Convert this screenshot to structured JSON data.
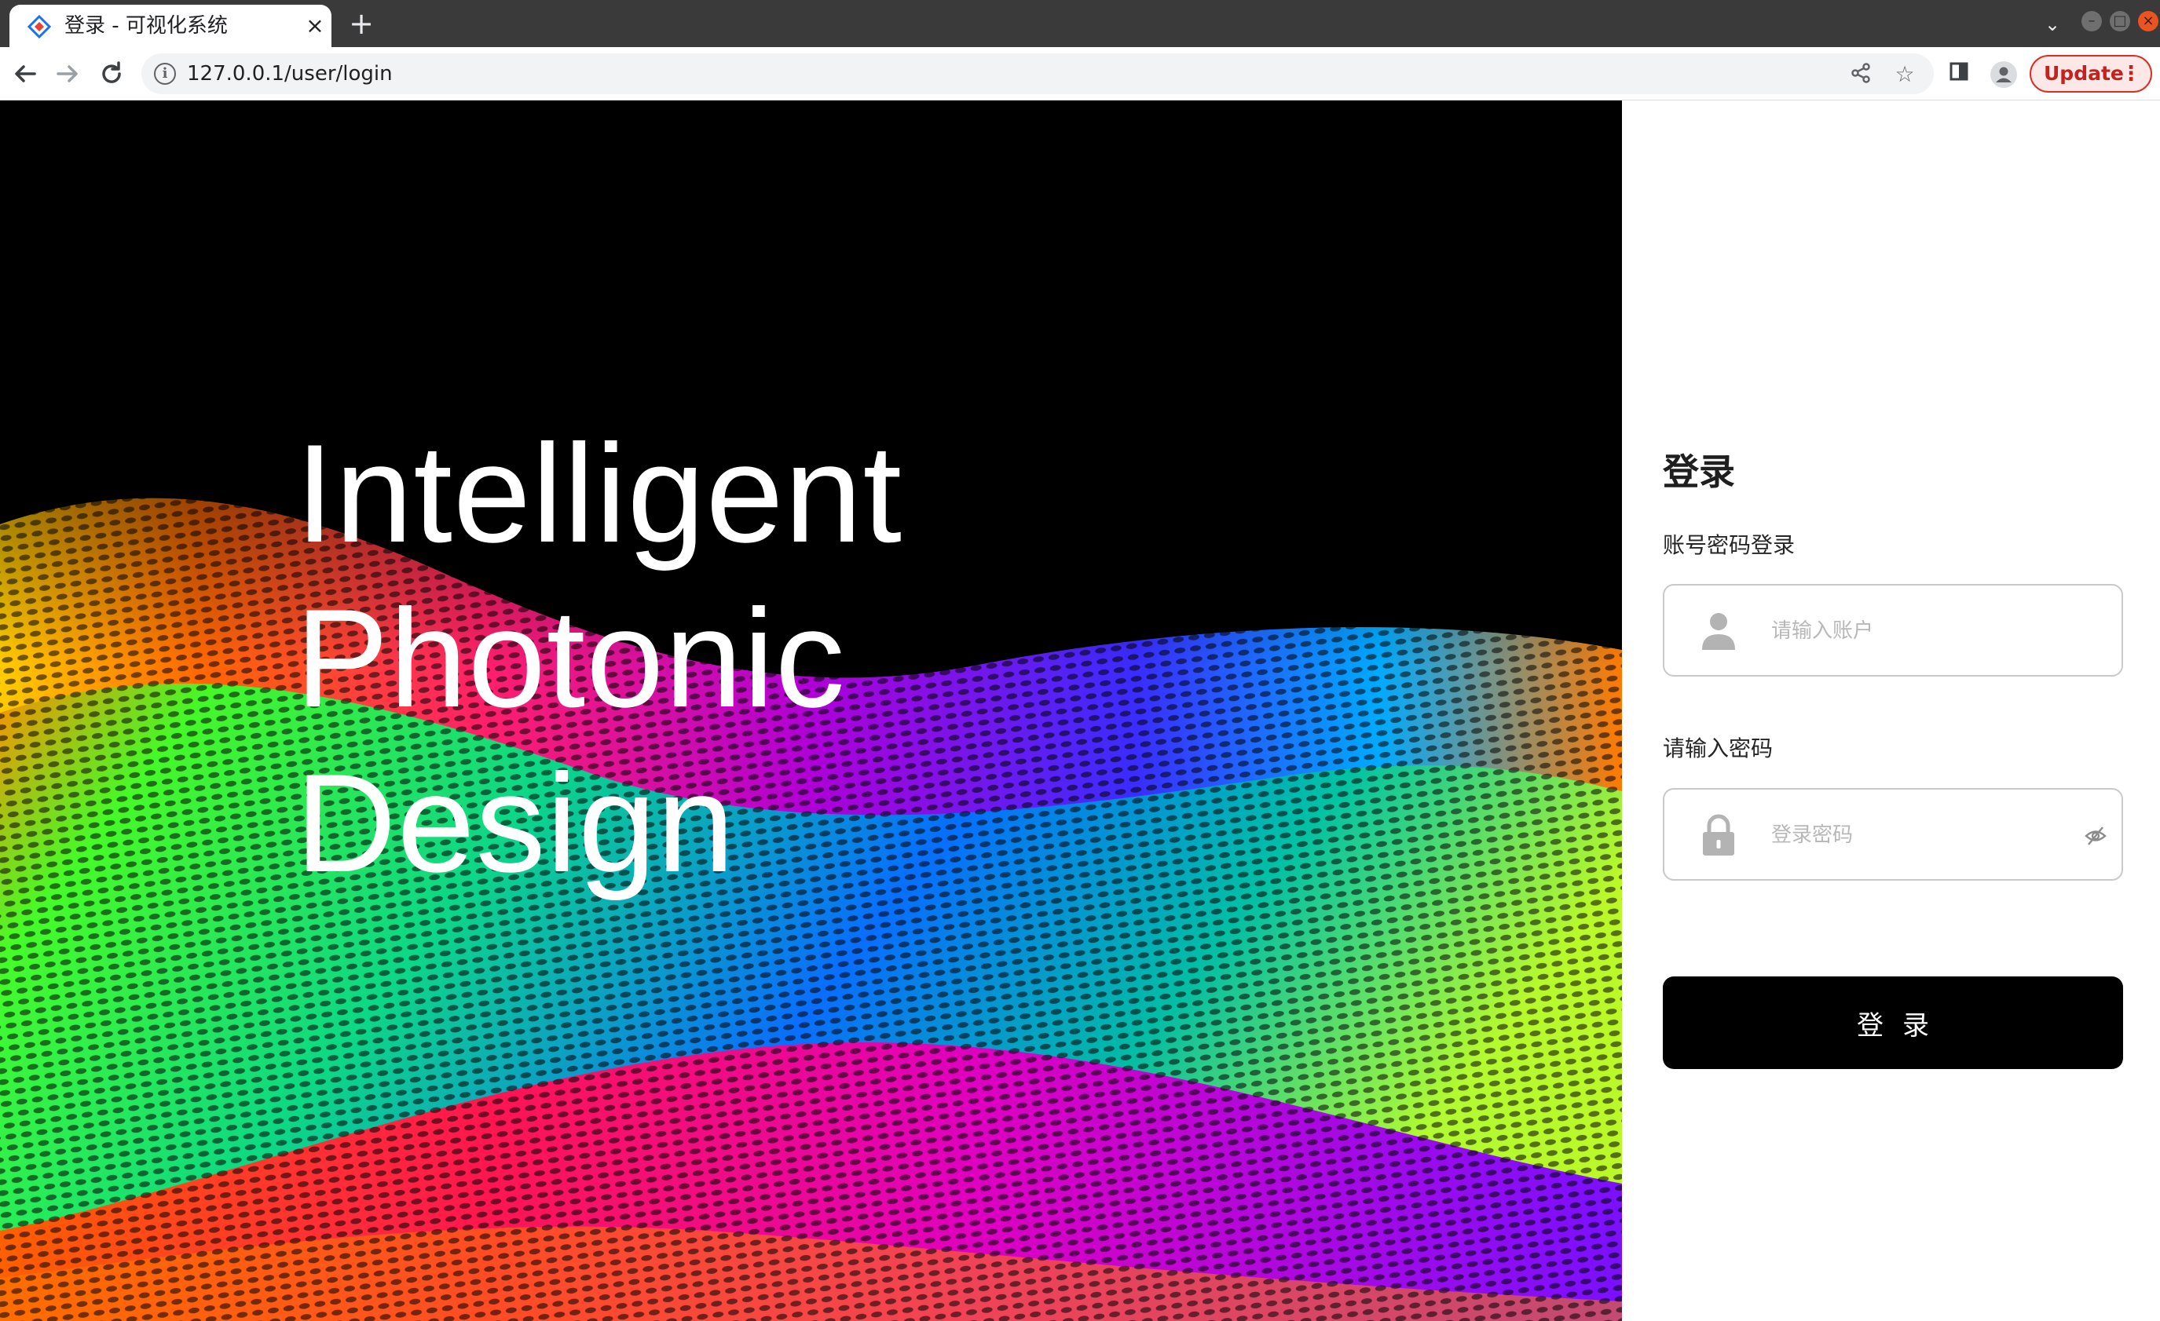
{
  "browser": {
    "tab_title": "登录 - 可视化系统",
    "tab_close": "×",
    "new_tab": "+",
    "url": "127.0.0.1/user/login",
    "update_label": "Update",
    "update_menu": "⋮"
  },
  "hero": {
    "lines": [
      "Intelligent",
      "Photonic",
      "Design"
    ]
  },
  "login": {
    "title": "登录",
    "subtitle": "账号密码登录",
    "username_placeholder": "请输入账户",
    "password_label": "请输入密码",
    "password_placeholder": "登录密码",
    "submit_label": "登录"
  },
  "colors": {
    "hero_background": "#000000",
    "button_background": "#000000",
    "update_accent": "#d93025"
  },
  "icons": {
    "tab_favicon": "diamond-logo-icon",
    "back": "arrow-left-icon",
    "forward": "arrow-right-icon",
    "reload": "reload-icon",
    "site_info": "info-icon",
    "share": "share-icon",
    "bookmark": "star-icon",
    "side_panel": "side-panel-icon",
    "profile": "profile-icon",
    "username_field": "user-icon",
    "password_field": "lock-icon",
    "toggle_password": "eye-off-icon"
  }
}
